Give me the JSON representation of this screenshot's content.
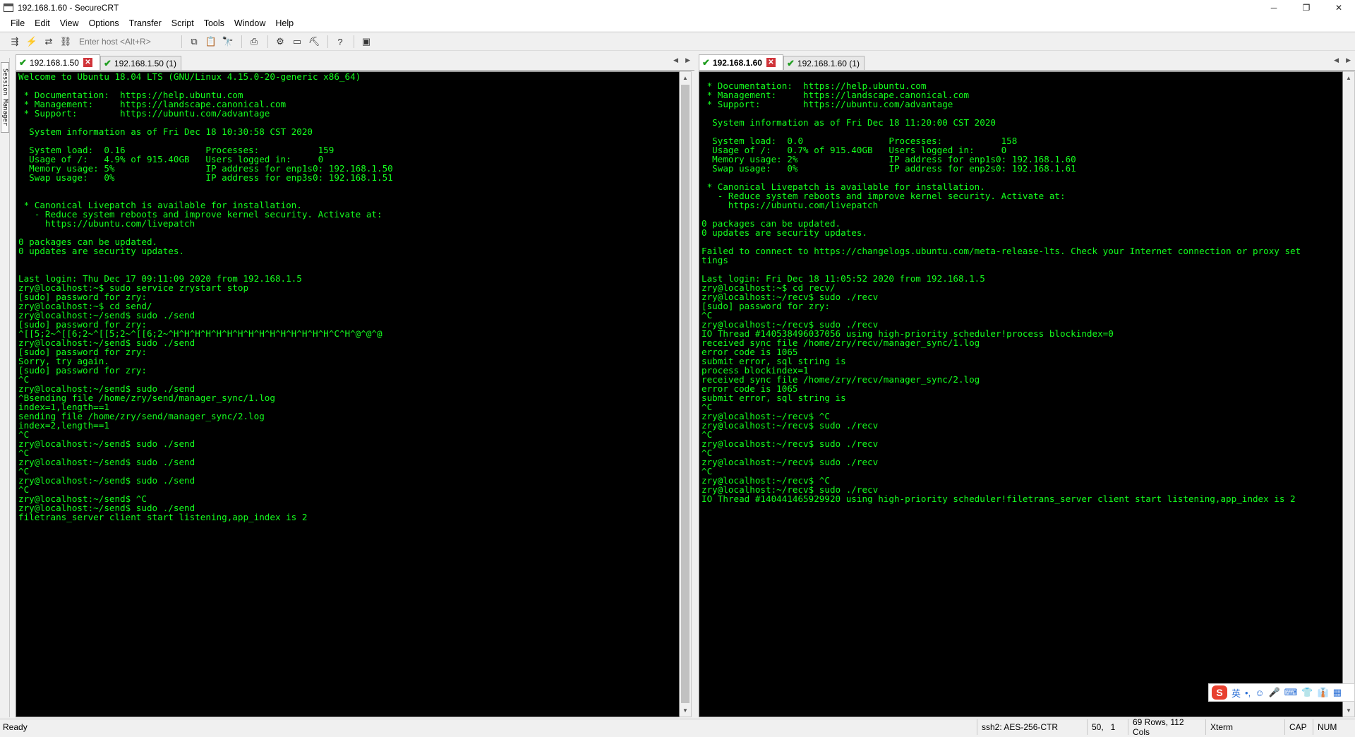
{
  "window": {
    "title": "192.168.1.60 - SecureCRT",
    "controls": {
      "minimize": "─",
      "restore": "❐",
      "close": "✕"
    }
  },
  "menu": [
    "File",
    "Edit",
    "View",
    "Options",
    "Transfer",
    "Script",
    "Tools",
    "Window",
    "Help"
  ],
  "toolbar": {
    "host_placeholder": "Enter host <Alt+R>",
    "icons": [
      "connect-icon",
      "quick-connect-icon",
      "reconnect-icon",
      "disconnect-icon",
      "copy-icon",
      "paste-icon",
      "find-icon",
      "print-icon",
      "settings-icon",
      "session-options-icon",
      "keymap-icon",
      "help-icon",
      "sftp-icon"
    ]
  },
  "session_manager": {
    "label": "Session Manager"
  },
  "left_pane": {
    "tabs": [
      {
        "label": "192.168.1.50",
        "active": true
      },
      {
        "label": "192.168.1.50 (1)",
        "active": false
      }
    ],
    "lines": [
      "Welcome to Ubuntu 18.04 LTS (GNU/Linux 4.15.0-20-generic x86_64)",
      "",
      " * Documentation:  https://help.ubuntu.com",
      " * Management:     https://landscape.canonical.com",
      " * Support:        https://ubuntu.com/advantage",
      "",
      "  System information as of Fri Dec 18 10:30:58 CST 2020",
      "",
      "  System load:  0.16               Processes:           159",
      "  Usage of /:   4.9% of 915.40GB   Users logged in:     0",
      "  Memory usage: 5%                 IP address for enp1s0: 192.168.1.50",
      "  Swap usage:   0%                 IP address for enp3s0: 192.168.1.51",
      "",
      "",
      " * Canonical Livepatch is available for installation.",
      "   - Reduce system reboots and improve kernel security. Activate at:",
      "     https://ubuntu.com/livepatch",
      "",
      "0 packages can be updated.",
      "0 updates are security updates.",
      "",
      "",
      "Last login: Thu Dec 17 09:11:09 2020 from 192.168.1.5",
      "zry@localhost:~$ sudo service zrystart stop",
      "[sudo] password for zry:",
      "zry@localhost:~$ cd send/",
      "zry@localhost:~/send$ sudo ./send",
      "[sudo] password for zry:",
      "^[[5;2~^[[6;2~^[[5;2~^[[6;2~^H^H^H^H^H^H^H^H^H^H^H^H^H^H^H^C^H^@^@^@",
      "zry@localhost:~/send$ sudo ./send",
      "[sudo] password for zry:",
      "Sorry, try again.",
      "[sudo] password for zry:",
      "^C",
      "zry@localhost:~/send$ sudo ./send",
      "^Bsending file /home/zry/send/manager_sync/1.log",
      "index=1,length==1",
      "sending file /home/zry/send/manager_sync/2.log",
      "index=2,length==1",
      "^C",
      "zry@localhost:~/send$ sudo ./send",
      "^C",
      "zry@localhost:~/send$ sudo ./send",
      "^C",
      "zry@localhost:~/send$ sudo ./send",
      "^C",
      "zry@localhost:~/send$ ^C",
      "zry@localhost:~/send$ sudo ./send",
      "filetrans_server client start listening,app_index is 2"
    ]
  },
  "right_pane": {
    "tabs": [
      {
        "label": "192.168.1.60",
        "active": true
      },
      {
        "label": "192.168.1.60 (1)",
        "active": false
      }
    ],
    "lines": [
      "",
      " * Documentation:  https://help.ubuntu.com",
      " * Management:     https://landscape.canonical.com",
      " * Support:        https://ubuntu.com/advantage",
      "",
      "  System information as of Fri Dec 18 11:20:00 CST 2020",
      "",
      "  System load:  0.0                Processes:           158",
      "  Usage of /:   0.7% of 915.40GB   Users logged in:     0",
      "  Memory usage: 2%                 IP address for enp1s0: 192.168.1.60",
      "  Swap usage:   0%                 IP address for enp2s0: 192.168.1.61",
      "",
      " * Canonical Livepatch is available for installation.",
      "   - Reduce system reboots and improve kernel security. Activate at:",
      "     https://ubuntu.com/livepatch",
      "",
      "0 packages can be updated.",
      "0 updates are security updates.",
      "",
      "Failed to connect to https://changelogs.ubuntu.com/meta-release-lts. Check your Internet connection or proxy set",
      "tings",
      "",
      "Last login: Fri Dec 18 11:05:52 2020 from 192.168.1.5",
      "zry@localhost:~$ cd recv/",
      "zry@localhost:~/recv$ sudo ./recv",
      "[sudo] password for zry:",
      "^C",
      "zry@localhost:~/recv$ sudo ./recv",
      "IO Thread #140538496037056 using high-priority scheduler!process blockindex=0",
      "received sync file /home/zry/recv/manager_sync/1.log",
      "error code is 1065",
      "submit error, sql string is",
      "process blockindex=1",
      "received sync file /home/zry/recv/manager_sync/2.log",
      "error code is 1065",
      "submit error, sql string is",
      "^C",
      "zry@localhost:~/recv$ ^C",
      "zry@localhost:~/recv$ sudo ./recv",
      "^C",
      "zry@localhost:~/recv$ sudo ./recv",
      "^C",
      "zry@localhost:~/recv$ sudo ./recv",
      "^C",
      "zry@localhost:~/recv$ ^C",
      "zry@localhost:~/recv$ sudo ./recv",
      "IO Thread #140441465929920 using high-priority scheduler!filetrans_server client start listening,app_index is 2"
    ]
  },
  "ime": {
    "logo": "S",
    "lang": "英",
    "items": [
      "•,",
      "☺",
      "🎤",
      "⌨",
      "👕",
      "👔",
      "▦"
    ]
  },
  "status": {
    "ready": "Ready",
    "cipher": "ssh2: AES-256-CTR",
    "cursor": "50,   1",
    "size": "69 Rows, 112 Cols",
    "terminal": "Xterm",
    "caps": "CAP",
    "num": "NUM"
  },
  "colors": {
    "terminal_bg": "#000000",
    "terminal_fg": "#14ff1e",
    "tab_check": "#1f9d1f",
    "tab_close": "#d0343a"
  }
}
